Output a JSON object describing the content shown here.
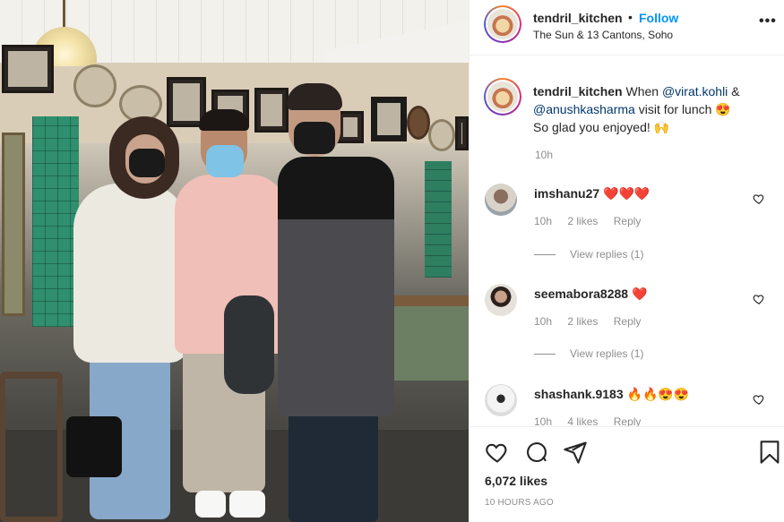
{
  "post": {
    "username": "tendril_kitchen",
    "separator": "•",
    "follow_label": "Follow",
    "location": "The Sun & 13 Cantons, Soho",
    "more_label": "•••"
  },
  "caption": {
    "username": "tendril_kitchen",
    "text_before": "When",
    "mention1": "@virat.kohli",
    "text_and": "&",
    "mention2": "@anushkasharma",
    "text_after": "visit for lunch",
    "emoji1": "😍",
    "line2": "So glad you enjoyed!",
    "emoji2": "🙌",
    "time": "10h"
  },
  "comments": [
    {
      "username": "imshanu27",
      "text": "❤️❤️❤️",
      "time": "10h",
      "likes": "2 likes",
      "reply": "Reply",
      "view_replies": "View replies (1)"
    },
    {
      "username": "seemabora8288",
      "text": "❤️",
      "time": "10h",
      "likes": "2 likes",
      "reply": "Reply",
      "view_replies": "View replies (1)"
    },
    {
      "username": "shashank.9183",
      "text": "🔥🔥😍😍",
      "time": "10h",
      "likes": "4 likes",
      "reply": "Reply"
    }
  ],
  "footer": {
    "likes": "6,072 likes",
    "time_ago": "10 HOURS AGO"
  },
  "icons": [
    "heart-icon",
    "comment-icon",
    "share-icon",
    "bookmark-icon",
    "more-icon"
  ],
  "colors": {
    "link_blue": "#0095f6",
    "mention": "#00376b",
    "meta_gray": "#8e8e8e",
    "heart_red": "#ed4956"
  }
}
